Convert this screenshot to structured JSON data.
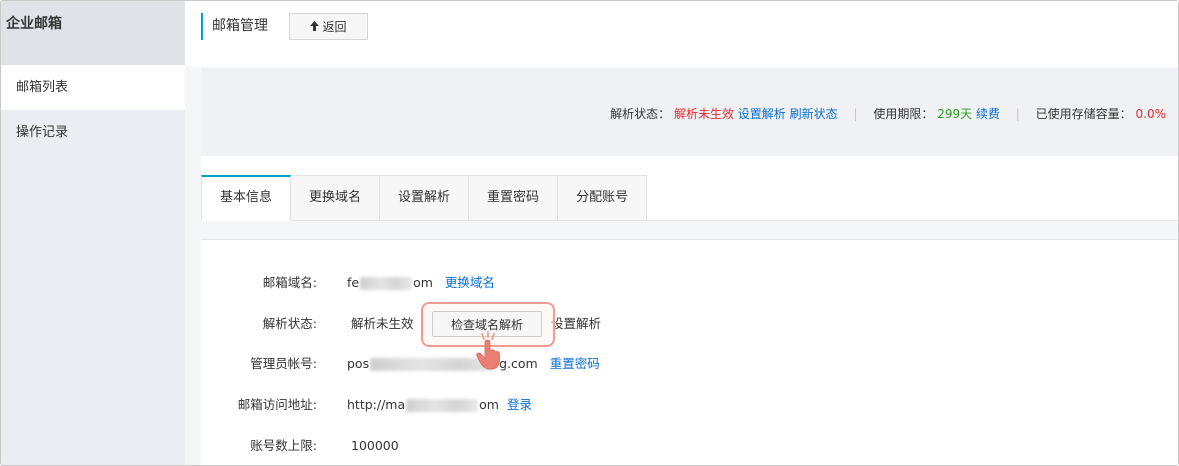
{
  "sidebar": {
    "title": "企业邮箱",
    "items": [
      {
        "label": "邮箱列表",
        "active": true
      },
      {
        "label": "操作记录",
        "active": false
      }
    ]
  },
  "header": {
    "title": "邮箱管理",
    "back_label": "返回",
    "back_icon": "arrow-up-icon"
  },
  "status": {
    "resolve_label": "解析状态：",
    "resolve_value": "解析未生效",
    "set_resolve": "设置解析",
    "refresh": "刷新状态",
    "expire_label": "使用期限：",
    "expire_value": "299天",
    "renew": "续费",
    "storage_label": "已使用存储容量：",
    "storage_value": "0.0%",
    "divider": "|"
  },
  "tabs": [
    {
      "label": "基本信息",
      "active": true
    },
    {
      "label": "更换域名",
      "active": false
    },
    {
      "label": "设置解析",
      "active": false
    },
    {
      "label": "重置密码",
      "active": false
    },
    {
      "label": "分配账号",
      "active": false
    }
  ],
  "info": {
    "domain_label": "邮箱域名:",
    "domain_prefix": "fe",
    "domain_suffix": "om",
    "domain_action": "更换域名",
    "resolve_label": "解析状态:",
    "resolve_value": "解析未生效",
    "check_button": "检查域名解析",
    "resolve_action": "设置解析",
    "admin_label": "管理员帐号:",
    "admin_prefix": "pos",
    "admin_suffix": "g.com",
    "admin_action": "重置密码",
    "url_label": "邮箱访问地址:",
    "url_prefix": "http://ma",
    "url_suffix": "om",
    "url_action": "登录",
    "limit_label": "账号数上限:",
    "limit_value": "100000"
  },
  "colors": {
    "accent": "#00a2ca",
    "error": "#e02d2d",
    "success": "#2ea11f",
    "link": "#0a6ecf",
    "highlight": "#f19c92"
  }
}
